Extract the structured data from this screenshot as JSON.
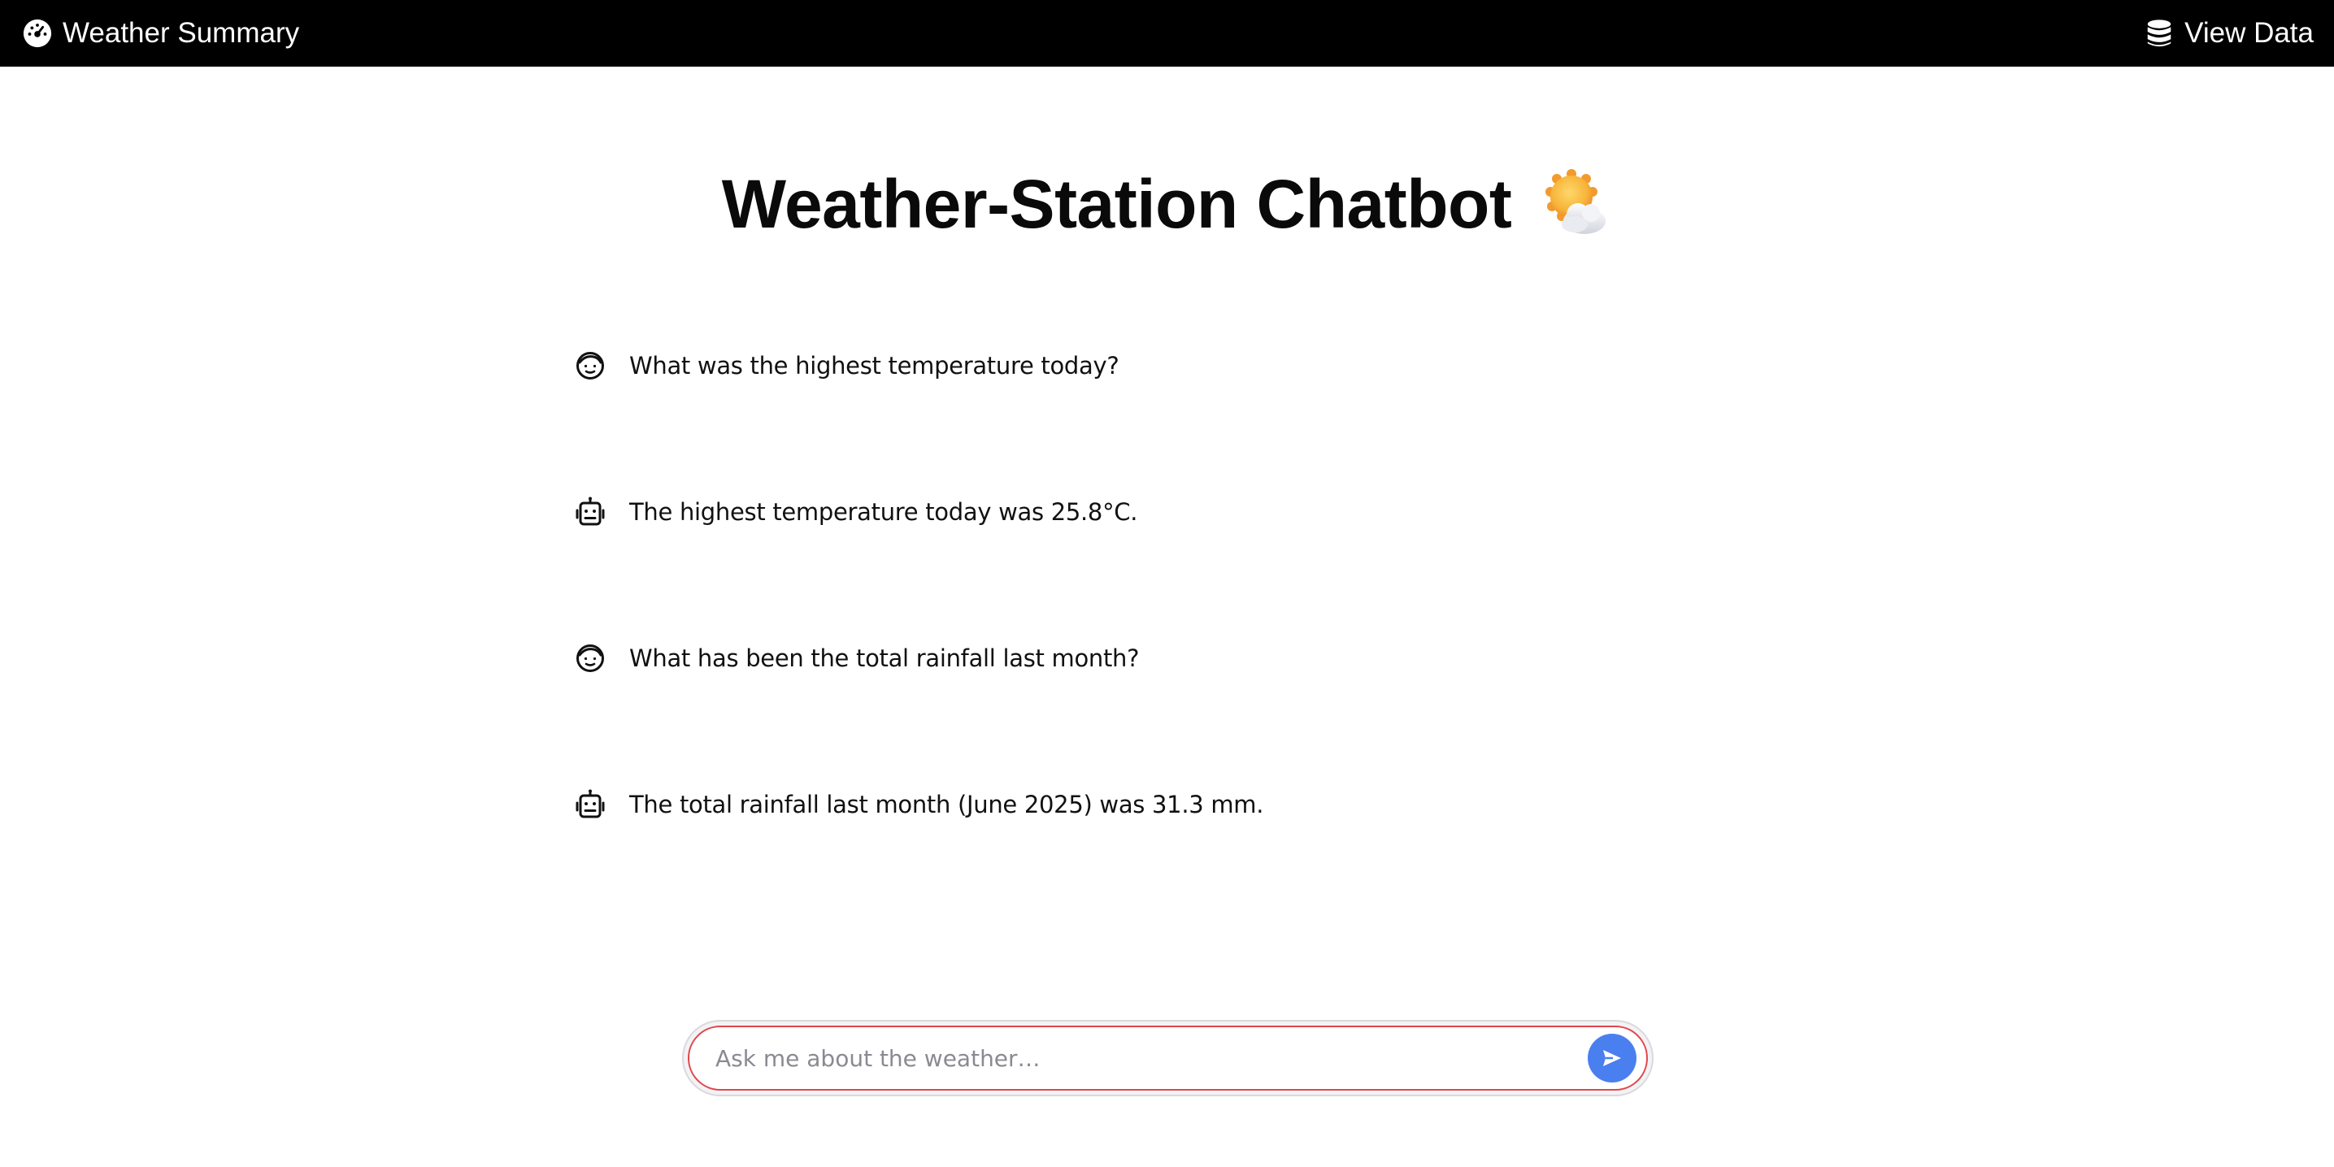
{
  "navbar": {
    "left_link": {
      "label": "Weather Summary",
      "icon": "gauge-icon"
    },
    "right_link": {
      "label": "View Data",
      "icon": "database-icon"
    },
    "background": "#000000"
  },
  "page": {
    "title": "Weather-Station Chatbot",
    "title_emoji": "sun-behind-cloud-icon"
  },
  "chat": {
    "messages": [
      {
        "role": "user",
        "avatar": "user-face-icon",
        "text": "What was the highest temperature today?"
      },
      {
        "role": "assistant",
        "avatar": "robot-icon",
        "text": "The highest temperature today was 25.8°C."
      },
      {
        "role": "user",
        "avatar": "user-face-icon",
        "text": "What has been the total rainfall last month?"
      },
      {
        "role": "assistant",
        "avatar": "robot-icon",
        "text": "The total rainfall last month (June 2025) was 31.3 mm."
      }
    ]
  },
  "input": {
    "placeholder": "Ask me about the weather…",
    "value": "",
    "send_icon": "send-icon",
    "accent": "#4a7ff0",
    "focus_border": "#e0474c"
  }
}
